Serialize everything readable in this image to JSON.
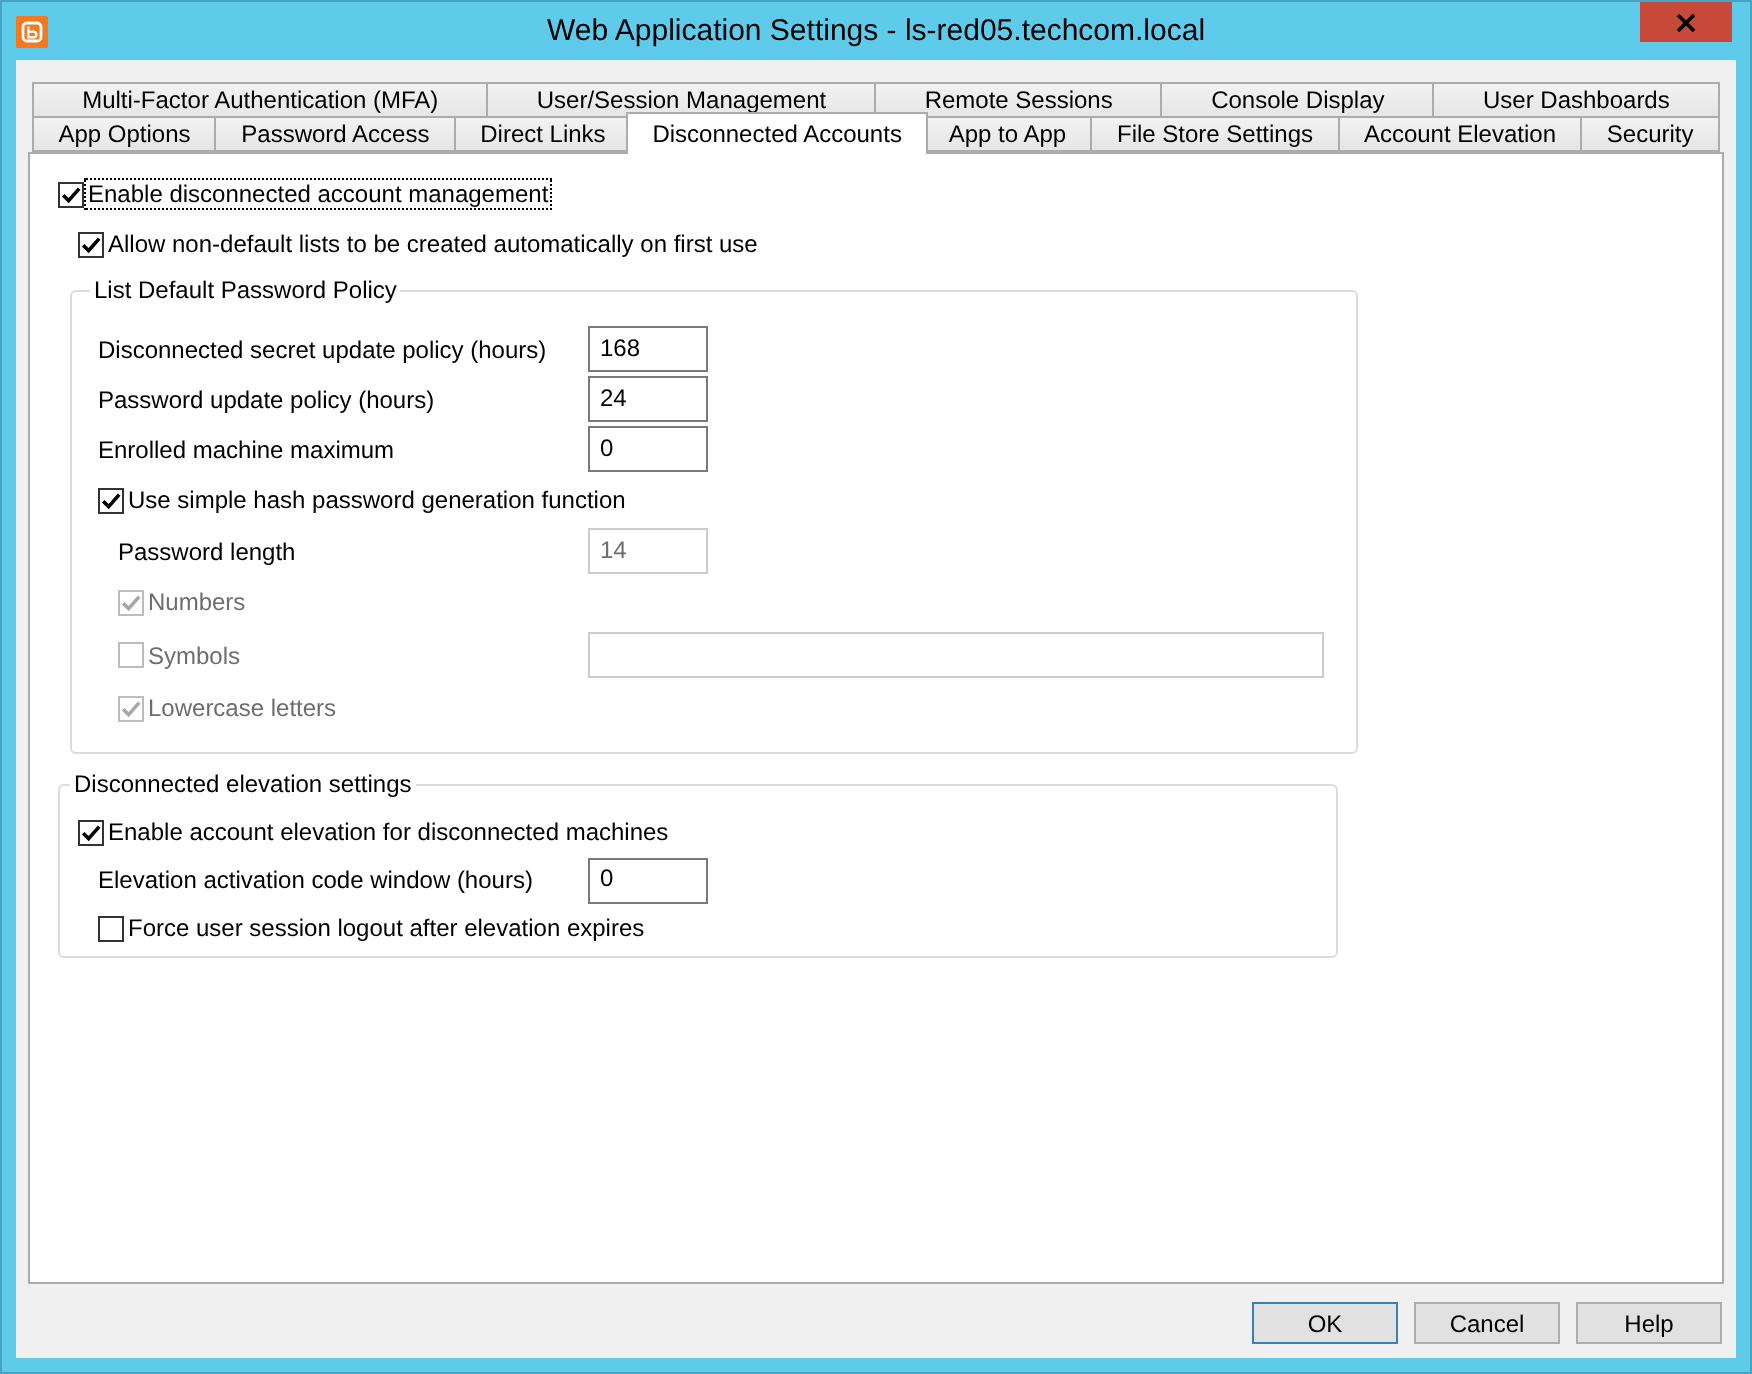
{
  "window": {
    "title": "Web Application Settings - ls-red05.techcom.local"
  },
  "tab_rows": [
    [
      {
        "label": "Multi-Factor Authentication (MFA)",
        "selected": false
      },
      {
        "label": "User/Session Management",
        "selected": false
      },
      {
        "label": "Remote Sessions",
        "selected": false
      },
      {
        "label": "Console Display",
        "selected": false
      },
      {
        "label": "User Dashboards",
        "selected": false
      }
    ],
    [
      {
        "label": "App Options",
        "selected": false
      },
      {
        "label": "Password Access",
        "selected": false
      },
      {
        "label": "Direct Links",
        "selected": false
      },
      {
        "label": "Disconnected Accounts",
        "selected": true
      },
      {
        "label": "App to App",
        "selected": false
      },
      {
        "label": "File Store Settings",
        "selected": false
      },
      {
        "label": "Account Elevation",
        "selected": false
      },
      {
        "label": "Security",
        "selected": false
      }
    ]
  ],
  "panel": {
    "options": [
      {
        "label": "Enable disconnected account management",
        "checked": true,
        "disabled": false,
        "focused": true
      },
      {
        "label": "Allow non-default lists to be created automatically on first use",
        "checked": true,
        "disabled": false,
        "focused": false
      }
    ],
    "groups": [
      {
        "title": "List Default Password Policy",
        "rows": [
          {
            "kind": "field",
            "label": "Disconnected secret update policy (hours)",
            "value": "168",
            "disabled": false
          },
          {
            "kind": "field",
            "label": "Password update policy (hours)",
            "value": "24",
            "disabled": false
          },
          {
            "kind": "field",
            "label": "Enrolled machine maximum",
            "value": "0",
            "disabled": false
          },
          {
            "kind": "checkbox",
            "label": "Use simple hash password generation function",
            "checked": true,
            "disabled": false,
            "children": [
              {
                "kind": "field",
                "label": "Password length",
                "value": "14",
                "disabled": true
              },
              {
                "kind": "checkbox",
                "label": "Numbers",
                "checked": true,
                "disabled": true
              },
              {
                "kind": "checkbox_field",
                "label": "Symbols",
                "checked": false,
                "disabled": true
              },
              {
                "kind": "checkbox",
                "label": "Lowercase letters",
                "checked": true,
                "disabled": true
              }
            ]
          }
        ]
      },
      {
        "title": "Disconnected elevation settings",
        "rows": [
          {
            "kind": "checkbox",
            "label": "Enable account elevation for disconnected machines",
            "checked": true,
            "disabled": false,
            "children": [
              {
                "kind": "field",
                "label": "Elevation activation code window (hours)",
                "value": "0",
                "disabled": false
              },
              {
                "kind": "checkbox",
                "label": "Force user session logout after elevation expires",
                "checked": false,
                "disabled": false
              }
            ]
          }
        ]
      }
    ]
  },
  "buttons": [
    {
      "label": "OK",
      "default": true
    },
    {
      "label": "Cancel",
      "default": false
    },
    {
      "label": "Help",
      "default": false
    }
  ]
}
